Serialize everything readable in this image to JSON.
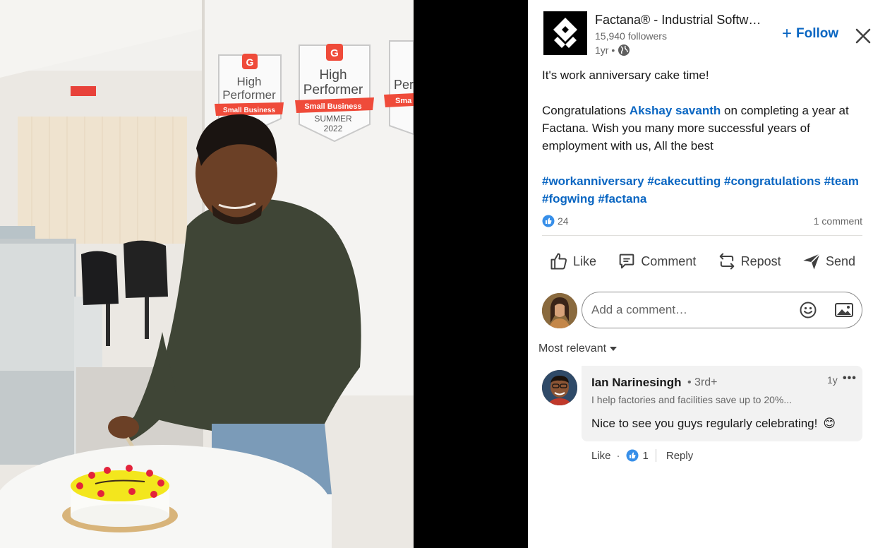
{
  "post": {
    "company_name": "Factana® - Industrial Softw…",
    "followers": "15,940 followers",
    "time": "1yr •",
    "follow_label": "Follow",
    "follow_plus": "+",
    "text_line1": "It's work anniversary cake time!",
    "congrats_prefix": "Congratulations ",
    "mention": "Akshay savanth",
    "congrats_suffix": " on completing a year at Factana. Wish you many more successful years of employment with us, All the best",
    "hashtags": [
      "#workanniversary",
      "#cakecutting",
      "#congratulations",
      "#team",
      "#fogwing",
      "#factana"
    ],
    "reaction_count": "24",
    "comment_count": "1 comment"
  },
  "actions": {
    "like": "Like",
    "comment": "Comment",
    "repost": "Repost",
    "send": "Send"
  },
  "comment_box": {
    "placeholder": "Add a comment…"
  },
  "sort": {
    "label": "Most relevant"
  },
  "comments": [
    {
      "name": "Ian Narinesingh",
      "degree": "• 3rd+",
      "time": "1y",
      "more": "•••",
      "headline": "I help factories and facilities save up to 20%...",
      "text": "Nice to see you guys regularly celebrating!",
      "emoji": "😊",
      "like_label": "Like",
      "dot": "·",
      "reaction_count": "1",
      "reply_label": "Reply"
    }
  ],
  "photo": {
    "badges": [
      {
        "line1": "High",
        "line2": "Performer",
        "ribbon": "Small Business",
        "extra1": "",
        "extra2": ""
      },
      {
        "line1": "High",
        "line2": "Performer",
        "ribbon": "Small Business",
        "extra1": "SUMMER",
        "extra2": "2022"
      },
      {
        "line1": "Per",
        "line2": "",
        "ribbon": "Sma",
        "extra1": "",
        "extra2": ""
      }
    ]
  },
  "colors": {
    "accent": "#0a66c2",
    "badge_red": "#ef4b3a",
    "sweater": "#3f4536"
  },
  "icons": [
    "close-icon",
    "globe-icon",
    "like-reaction-icon",
    "thumbs-up-icon",
    "comment-icon",
    "repost-icon",
    "send-icon",
    "emoji-icon",
    "image-icon",
    "caret-down-icon"
  ]
}
